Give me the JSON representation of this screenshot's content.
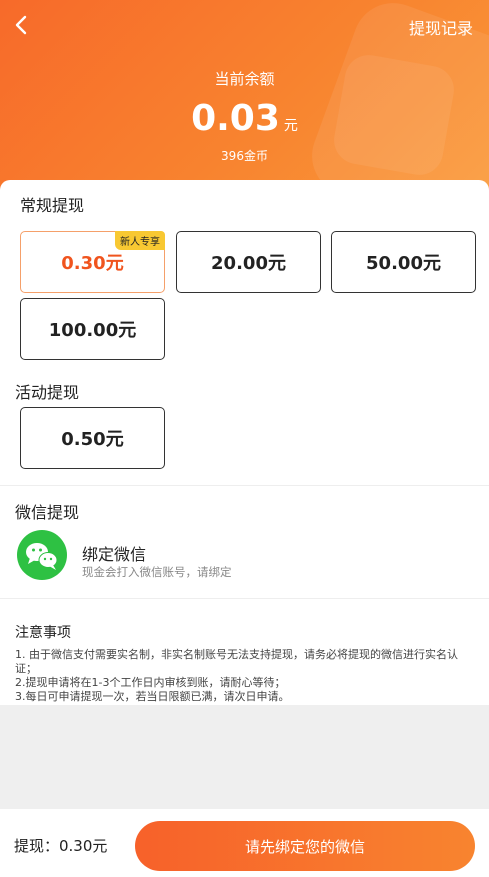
{
  "header": {
    "record_label": "提现记录",
    "balance_label": "当前余额",
    "balance_amount": "0.03",
    "balance_unit": "元",
    "coins": "396金币"
  },
  "regular": {
    "title": "常规提现",
    "options": [
      {
        "label": "0.30元",
        "badge": "新人专享",
        "selected": true
      },
      {
        "label": "20.00元"
      },
      {
        "label": "50.00元"
      },
      {
        "label": "100.00元"
      }
    ]
  },
  "activity": {
    "title": "活动提现",
    "options": [
      {
        "label": "0.50元"
      }
    ]
  },
  "wechat": {
    "title": "微信提现",
    "bind_title": "绑定微信",
    "bind_sub": "现金会打入微信账号，请绑定"
  },
  "notes": {
    "title": "注意事项",
    "items": [
      "1. 由于微信支付需要实名制，非实名制账号无法支持提现，请务必将提现的微信进行实名认证；",
      "2.提现申请将在1-3个工作日内审核到账，请耐心等待；",
      "3.每日可申请提现一次，若当日限额已满，请次日申请。"
    ]
  },
  "bottom": {
    "withdraw_label": "提现：0.30元",
    "button_label": "请先绑定您的微信"
  },
  "colors": {
    "accent": "#f7692b",
    "wechat_green": "#2ec143"
  }
}
